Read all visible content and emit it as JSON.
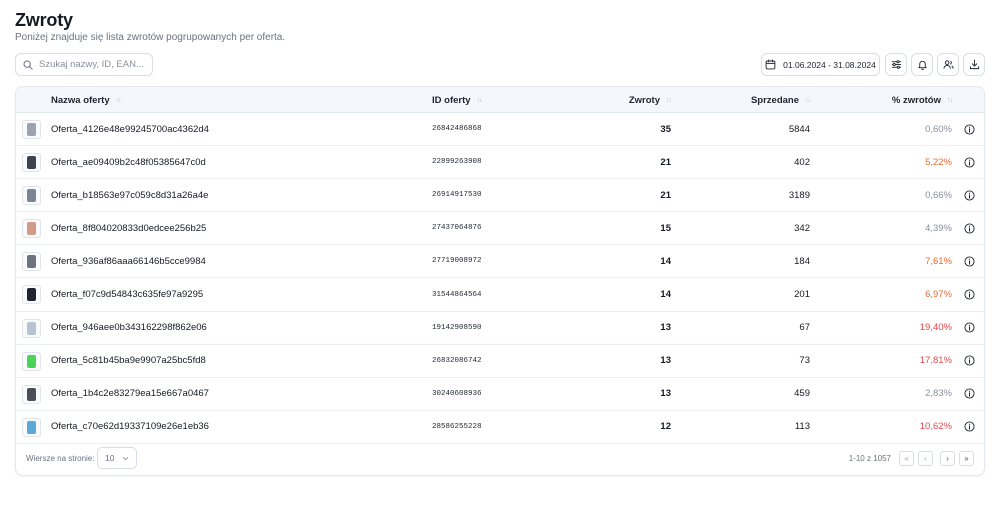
{
  "header": {
    "title": "Zwroty",
    "subtitle": "Poniżej znajduje się lista zwrotów pogrupowanych per oferta."
  },
  "search": {
    "placeholder": "Szukaj nazwy, ID, EAN...",
    "value": ""
  },
  "toolbar": {
    "date_range": "01.06.2024 - 31.08.2024",
    "icons": [
      "calendar-icon",
      "filter-sliders-icon",
      "bell-icon",
      "users-icon",
      "download-icon"
    ]
  },
  "table": {
    "columns": {
      "name": "Nazwa oferty",
      "id": "ID oferty",
      "returns": "Zwroty",
      "sold": "Sprzedane",
      "rate": "% zwrotów"
    },
    "rows": [
      {
        "name": "Oferta_4126e48e99245700ac4362d4",
        "id": "26842486868",
        "returns": "35",
        "sold": "5844",
        "rate": "0,60%",
        "rate_color": "#8a909b",
        "thumb_color": "#9aa3b0"
      },
      {
        "name": "Oferta_ae09409b2c48f05385647c0d",
        "id": "22899263908",
        "returns": "21",
        "sold": "402",
        "rate": "5,22%",
        "rate_color": "#ea6a2e",
        "thumb_color": "#3b4350"
      },
      {
        "name": "Oferta_b18563e97c059c8d31a26a4e",
        "id": "26914917530",
        "returns": "21",
        "sold": "3189",
        "rate": "0,66%",
        "rate_color": "#8a909b",
        "thumb_color": "#7c8593"
      },
      {
        "name": "Oferta_8f804020833d0edcee256b25",
        "id": "27437064876",
        "returns": "15",
        "sold": "342",
        "rate": "4,39%",
        "rate_color": "#8a909b",
        "thumb_color": "#d39a8a"
      },
      {
        "name": "Oferta_936af86aaa66146b5cce9984",
        "id": "27719008972",
        "returns": "14",
        "sold": "184",
        "rate": "7,61%",
        "rate_color": "#ea6a2e",
        "thumb_color": "#6b7280"
      },
      {
        "name": "Oferta_f07c9d54843c635fe97a9295",
        "id": "31544864564",
        "returns": "14",
        "sold": "201",
        "rate": "6,97%",
        "rate_color": "#ea6a2e",
        "thumb_color": "#1f2430"
      },
      {
        "name": "Oferta_946aee0b343162298f862e06",
        "id": "19142908590",
        "returns": "13",
        "sold": "67",
        "rate": "19,40%",
        "rate_color": "#e5484d",
        "thumb_color": "#b7c4d3"
      },
      {
        "name": "Oferta_5c81b45ba9e9907a25bc5fd8",
        "id": "26832086742",
        "returns": "13",
        "sold": "73",
        "rate": "17,81%",
        "rate_color": "#e5484d",
        "thumb_color": "#49d35a"
      },
      {
        "name": "Oferta_1b4c2e83279ea15e667a0467",
        "id": "30240608936",
        "returns": "13",
        "sold": "459",
        "rate": "2,83%",
        "rate_color": "#8a909b",
        "thumb_color": "#4a4f5a"
      },
      {
        "name": "Oferta_c70e62d19337109e26e1eb36",
        "id": "28586255228",
        "returns": "12",
        "sold": "113",
        "rate": "10,62%",
        "rate_color": "#e5484d",
        "thumb_color": "#5aa9d6"
      }
    ]
  },
  "footer": {
    "rows_per_page_label": "Wiersze na stronie:",
    "rows_per_page_value": "10",
    "range_text": "1-10 z 1057",
    "pagination": {
      "first": "«",
      "prev": "‹",
      "next": "›",
      "last": "»"
    }
  }
}
